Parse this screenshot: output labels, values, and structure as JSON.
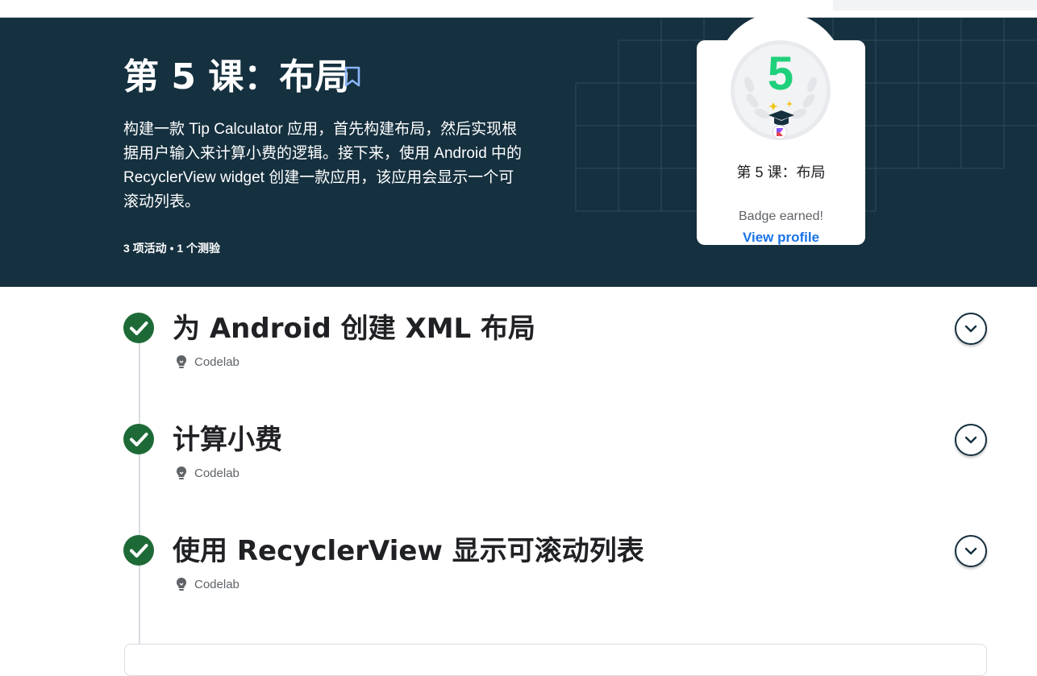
{
  "lesson": {
    "title": "第 5 课：布局",
    "description": "构建一款 Tip Calculator 应用，首先构建布局，然后实现根据用户输入来计算小费的逻辑。接下来，使用 Android 中的 RecyclerView widget 创建一款应用，该应用会显示一个可滚动列表。",
    "meta": "3 项活动 • 1 个测验"
  },
  "badge": {
    "number": "5",
    "name": "第 5 课：布局",
    "earned_label": "Badge earned!",
    "view_profile_label": "View profile"
  },
  "activities": [
    {
      "title": "为 Android 创建 XML 布局",
      "type": "Codelab",
      "completed": true
    },
    {
      "title": "计算小费",
      "type": "Codelab",
      "completed": true
    },
    {
      "title": "使用 RecyclerView 显示可滚动列表",
      "type": "Codelab",
      "completed": true
    }
  ],
  "icons": {
    "bookmark": "bookmark-outline-icon",
    "check": "check-circle-icon",
    "codelab": "lightbulb-icon",
    "expand": "chevron-down-icon"
  },
  "colors": {
    "hero_bg": "#15303f",
    "badge_number": "#1fd07b",
    "check_green": "#1e6a37",
    "link_blue": "#1a73e8"
  }
}
